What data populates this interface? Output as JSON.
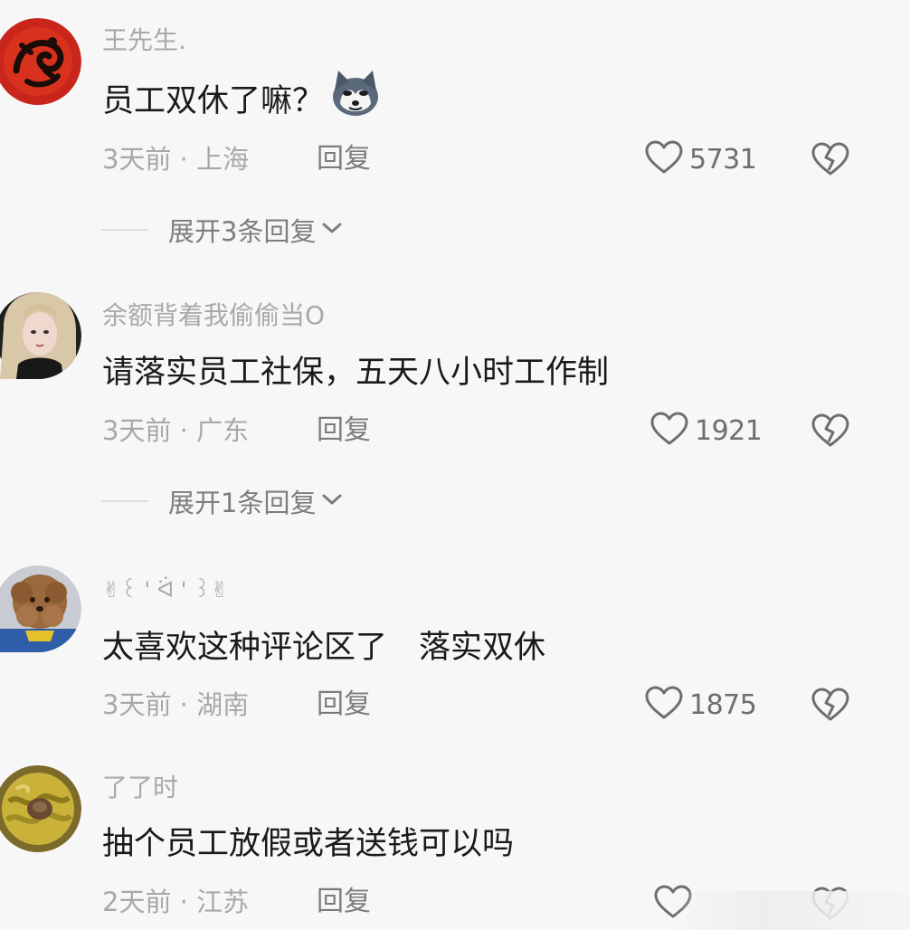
{
  "comments": [
    {
      "username": "王先生.",
      "content": "员工双休了嘛？",
      "time": "3天前",
      "location": "上海",
      "reply_label": "回复",
      "likes": "5731",
      "expand_label": "展开3条回复"
    },
    {
      "username": "余额背着我偷偷当O",
      "content": "请落实员工社保，五天八小时工作制",
      "time": "3天前",
      "location": "广东",
      "reply_label": "回复",
      "likes": "1921",
      "expand_label": "展开1条回复"
    },
    {
      "username": "✌︎꒰ ' ᐛ ' ꒱✌︎",
      "content": "太喜欢这种评论区了　落实双休",
      "time": "3天前",
      "location": "湖南",
      "reply_label": "回复",
      "likes": "1875"
    },
    {
      "username": "了了时",
      "content": "抽个员工放假或者送钱可以吗",
      "time": "2天前",
      "location": "江苏",
      "reply_label": "回复"
    }
  ],
  "separator": " · ",
  "icons": {
    "like": "heart-outline-icon",
    "dislike": "broken-heart-icon",
    "expand": "chevron-down-icon"
  },
  "colors": {
    "background": "#f7f7f7",
    "text_primary": "#1a1a1a",
    "text_secondary": "#a8a8a8"
  }
}
